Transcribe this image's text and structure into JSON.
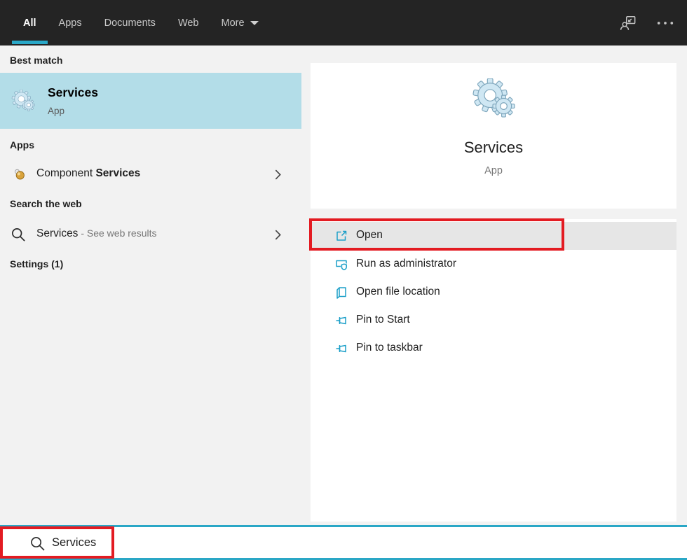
{
  "topbar": {
    "tabs": [
      {
        "label": "All",
        "active": true
      },
      {
        "label": "Apps",
        "active": false
      },
      {
        "label": "Documents",
        "active": false
      },
      {
        "label": "Web",
        "active": false
      },
      {
        "label": "More",
        "active": false
      }
    ]
  },
  "left_panel": {
    "best_match_header": "Best match",
    "best_match": {
      "title": "Services",
      "subtitle": "App"
    },
    "apps_header": "Apps",
    "component_services": {
      "prefix": "Component ",
      "match": "Services"
    },
    "web_header": "Search the web",
    "web_result": {
      "query": "Services",
      "suffix": " - See web results"
    },
    "settings_header": "Settings (1)"
  },
  "right_panel": {
    "title": "Services",
    "subtitle": "App",
    "actions": [
      {
        "label": "Open",
        "icon": "open-icon",
        "highlighted": true
      },
      {
        "label": "Run as administrator",
        "icon": "admin-shield-icon",
        "highlighted": false
      },
      {
        "label": "Open file location",
        "icon": "file-location-icon",
        "highlighted": false
      },
      {
        "label": "Pin to Start",
        "icon": "pin-icon",
        "highlighted": false
      },
      {
        "label": "Pin to taskbar",
        "icon": "pin-icon",
        "highlighted": false
      }
    ]
  },
  "search_bar": {
    "value": "Services"
  },
  "colors": {
    "accent": "#1b9fc8",
    "topbar-bg": "#242424",
    "underline": "#2aa8c8",
    "panel-bg": "#f2f2f2",
    "highlight": "#b3dde8",
    "row-hover": "#e6e6e6",
    "annotation-red": "#e31b22",
    "search-border": "#2aa7c6",
    "text-dark": "#1f1f1f",
    "text-gray": "#767676"
  }
}
